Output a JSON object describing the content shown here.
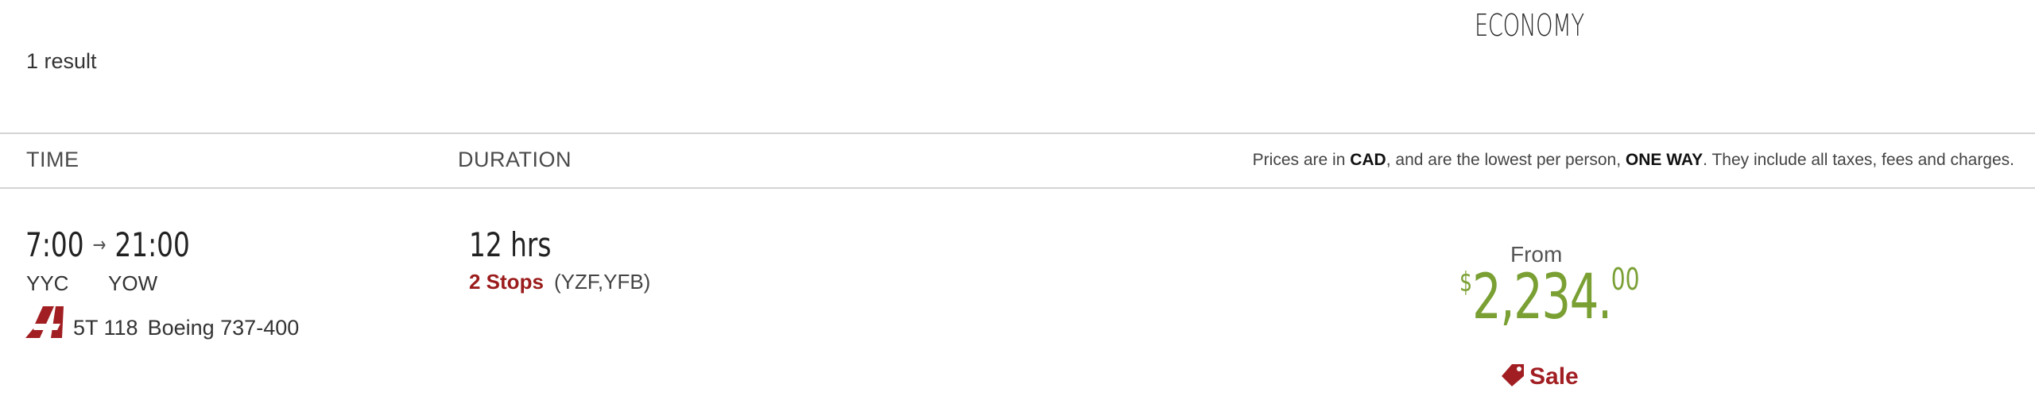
{
  "fare_header": "ECONOMY",
  "result_count": "1 result",
  "columns": {
    "time": "TIME",
    "duration": "DURATION"
  },
  "price_note": {
    "part1": "Prices are in ",
    "currency": "CAD",
    "part2": ", and are the lowest per person, ",
    "trip_type": "ONE WAY",
    "part3": ". They include all taxes, fees and charges."
  },
  "flight": {
    "depart_time": "7:00",
    "arrow": "→",
    "arrive_time": "21:00",
    "origin": "YYC",
    "destination": "YOW",
    "airline_icon": "airline-logo-icon",
    "flight_number": "5T 118",
    "aircraft": "Boeing 737-400",
    "duration": "12 hrs",
    "stops": "2 Stops",
    "via": "(YZF,YFB)",
    "price_label": "From",
    "price_currency": "$",
    "price_main": "2,234.",
    "price_cents": "00",
    "sale_icon": "tag-icon",
    "sale_label": "Sale"
  },
  "colors": {
    "price": "#7aa034",
    "accent": "#9b1c1c"
  }
}
